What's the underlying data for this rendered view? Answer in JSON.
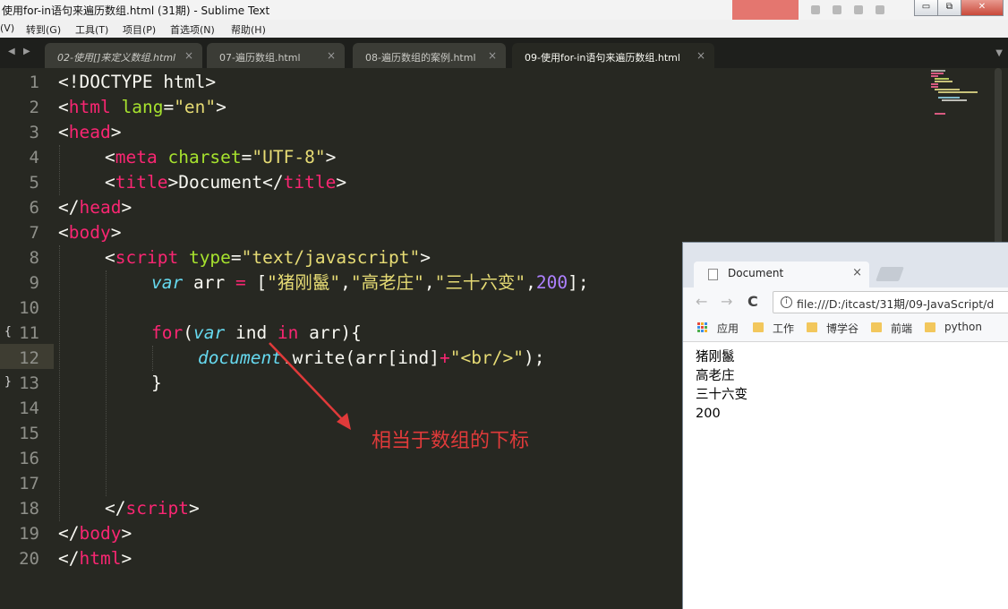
{
  "window": {
    "title": "使用for-in语句来遍历数组.html (31期) - Sublime Text",
    "controls": {
      "minimize": "▭",
      "restore": "⧉",
      "close": "✕"
    }
  },
  "menu": [
    "(V)",
    "转到(G)",
    "工具(T)",
    "项目(P)",
    "首选项(N)",
    "帮助(H)"
  ],
  "tabs": [
    {
      "label": "02-使用[]来定义数组.html",
      "italic": true
    },
    {
      "label": "07-遍历数组.html"
    },
    {
      "label": "08-遍历数组的案例.html"
    },
    {
      "label": "09-使用for-in语句来遍历数组.html",
      "active": true
    }
  ],
  "tab_close": "×",
  "tab_nav": {
    "prev": "◀",
    "next": "▶",
    "menu": "▼"
  },
  "line_numbers": [
    "1",
    "2",
    "3",
    "4",
    "5",
    "6",
    "7",
    "8",
    "9",
    "10",
    "11",
    "12",
    "13",
    "14",
    "15",
    "16",
    "17",
    "18",
    "19",
    "20"
  ],
  "fold_marks": {
    "open": "{",
    "close": "}"
  },
  "code": {
    "l1": {
      "a": "<!DOCTYPE html>"
    },
    "l2": {
      "lt": "<",
      "tag": "html",
      "sp": " ",
      "attr": "lang",
      "eq": "=",
      "val": "\"en\"",
      "gt": ">"
    },
    "l3": {
      "lt": "<",
      "tag": "head",
      "gt": ">"
    },
    "l4": {
      "lt": "<",
      "tag": "meta",
      "sp": " ",
      "attr": "charset",
      "eq": "=",
      "val": "\"UTF-8\"",
      "gt": ">"
    },
    "l5": {
      "lt": "<",
      "tag": "title",
      "gt": ">",
      "text": "Document",
      "lt2": "</",
      "tag2": "title",
      "gt2": ">"
    },
    "l6": {
      "lt": "</",
      "tag": "head",
      "gt": ">"
    },
    "l7": {
      "lt": "<",
      "tag": "body",
      "gt": ">"
    },
    "l8": {
      "lt": "<",
      "tag": "script",
      "sp": " ",
      "attr": "type",
      "eq": "=",
      "val": "\"text/javascript\"",
      "gt": ">"
    },
    "l9": {
      "kw": "var",
      "mid": " arr ",
      "eq": "=",
      "open": " [",
      "s1": "\"猪刚鬣\"",
      "c1": ",",
      "s2": "\"高老庄\"",
      "c2": ",",
      "s3": "\"三十六变\"",
      "c3": ",",
      "num": "200",
      "close": "];"
    },
    "l11": {
      "for": "for",
      "p1": "(",
      "kw": "var",
      "v": " ind ",
      "in": "in",
      "rest": " arr){"
    },
    "l12": {
      "obj": "document",
      "dot": ".",
      "fn": "write(arr[ind]",
      "plus": "+",
      "str": "\"<br/>\"",
      "end": ");"
    },
    "l13": {
      "brace": "}"
    },
    "l18": {
      "lt": "</",
      "tag": "script",
      "gt": ">"
    },
    "l19": {
      "lt": "</",
      "tag": "body",
      "gt": ">"
    },
    "l20": {
      "lt": "</",
      "tag": "html",
      "gt": ">"
    }
  },
  "annotation": "相当于数组的下标",
  "colors": {
    "tag": "#f92672",
    "attr": "#a6e22e",
    "string": "#e6db74",
    "keyword": "#66d9ef",
    "number": "#ae81ff",
    "annotation": "#e03a3a"
  },
  "browser": {
    "tab_title": "Document",
    "tab_close": "×",
    "nav": {
      "back": "←",
      "forward": "→",
      "reload": "C"
    },
    "info": "i",
    "url": "file:///D:/itcast/31期/09-JavaScript/d",
    "bookmarks": [
      "应用",
      "工作",
      "博学谷",
      "前端",
      "python"
    ],
    "output": [
      "猪刚鬣",
      "高老庄",
      "三十六变",
      "200"
    ]
  }
}
